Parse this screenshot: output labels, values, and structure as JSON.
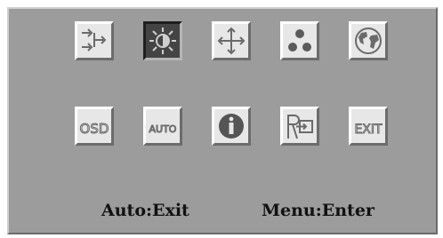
{
  "menu": {
    "row1": [
      {
        "id": "input-source",
        "icon": "input-source-icon"
      },
      {
        "id": "brightness",
        "icon": "brightness-icon"
      },
      {
        "id": "position",
        "icon": "position-arrows-icon"
      },
      {
        "id": "color",
        "icon": "color-dots-icon"
      },
      {
        "id": "language",
        "icon": "globe-icon"
      }
    ],
    "row2": [
      {
        "id": "osd",
        "icon": "osd-icon",
        "label": "OSD"
      },
      {
        "id": "auto",
        "icon": "auto-icon",
        "label": "AUTO"
      },
      {
        "id": "information",
        "icon": "info-icon"
      },
      {
        "id": "recall",
        "icon": "recall-icon"
      },
      {
        "id": "exit",
        "icon": "exit-icon",
        "label": "EXIT"
      }
    ],
    "selected": "brightness"
  },
  "hints": {
    "auto_hint": "Auto:Exit",
    "menu_hint": "Menu:Enter"
  },
  "colors": {
    "panel": "#9c9c9c",
    "tile": "#e7e7e7",
    "tile_selected": "#444444",
    "icon_stroke": "#6a6a6a"
  }
}
